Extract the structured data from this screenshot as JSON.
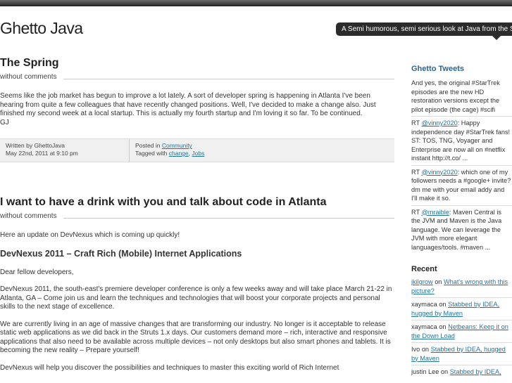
{
  "site": {
    "title": "Ghetto Java",
    "tagline": "A Semi humorous, semi serious look at Java from the Street"
  },
  "post1": {
    "title": "The Spring",
    "comments": "without comments",
    "body": [
      "Seems like the job market has begun to improve a lot lately. A sort of developer spring is happening in Atlanta I've been hearing from quite a few colleagues that have recently changed positions. Well, I've decided to make a change also. Just finished my second week at a local startup. This is actually my fourth startup and I'm loving it so far. To be continued.",
      "GJ"
    ],
    "meta": {
      "written_by": "Written by GhettoJava",
      "date": "May 22nd, 2011 at 9:10 pm",
      "posted_in_label": "Posted in",
      "category": "Community",
      "tagged_label": "Tagged with",
      "tag1": "change",
      "sep": ",",
      "tag2": "Jobs"
    }
  },
  "post2": {
    "title": "I want to have a drink with you and talk about code in Atlanta",
    "comments": "without comments",
    "intro": "Here an update on DevNexus which is coming up quickly!",
    "subtitle": "DevNexus 2011 – Craft Rich (Mobile) Internet Applications",
    "greeting": "Dear fellow developers,",
    "para1": "DevNexus 2011, the south-east's premiere developer conference is only a few weeks away and will take place March 21-22 in Atlanta, GA – Come join us and learn the techniques and technologies that will boost your corporate projects and personal skills to the next stage of excellence.",
    "para2": "We are currently living in an age of massive changes that are transforming our industry. No longer is it acceptable to release static web applications as we did back in the Struts 1.x days. Our customers demand more – rich, interactive and responsive applications that also need to be available across multiple devices – not only desktops but also smart phones and tablets. It is becoming the new reality – Prepare yourself!",
    "para3": "DevNexus will help you discover the possibilities and techniques to master this exciting world of Rich Internet"
  },
  "sidebar": {
    "tweets_title": "Ghetto Tweets",
    "tweets": [
      {
        "pre": "And yes, the original #StarTrek episodes are the new HD restoration versions except the pilot episode (the cage) #scifi"
      },
      {
        "rt": "RT ",
        "handle": "@vinny2020",
        "text": ": Happy independence day #StarTrek fans! ST: TOS, TNG, Voyager and Enterprise are now all on #netflix instant http://t.co/ ..."
      },
      {
        "rt": "RT ",
        "handle": "@vinny2020",
        "text": ": which one of my followers needs a #google+ invite? dm me with your email addy and I'll make it so."
      },
      {
        "rt": "RT ",
        "handle": "@mraible",
        "text": ": Maven Central is the JVM and Maven is the Java language. We can leverage the JVM with more elegant languages/tools. #maven ..."
      }
    ],
    "recent_title": "Recent",
    "recent": [
      {
        "author": "jkilgrow",
        "author_link": true,
        "on": " on ",
        "post": "What's wrong with this picture?"
      },
      {
        "author": "xaymaca",
        "author_link": false,
        "on": " on ",
        "post": "Stabbed by IDEA, hugged by Maven"
      },
      {
        "author": "xaymaca",
        "author_link": false,
        "on": " on ",
        "post": "Netbeans: Keep it on the Down Load"
      },
      {
        "author": "Ivo",
        "author_link": false,
        "on": " on ",
        "post": "Stabbed by IDEA, hugged by Maven"
      },
      {
        "author": "justin Lee",
        "author_link": false,
        "on": " on ",
        "post": "Stabbed by IDEA,"
      }
    ]
  }
}
